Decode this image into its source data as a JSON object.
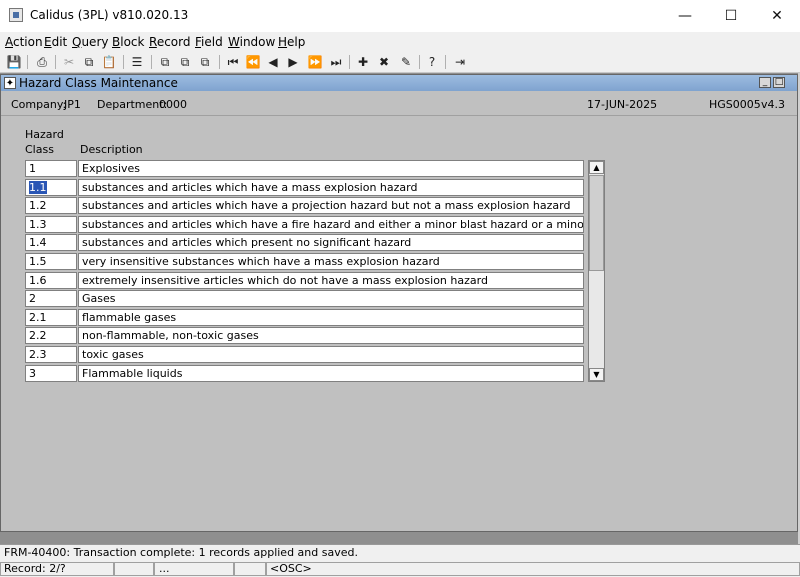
{
  "window": {
    "title": "Calidus (3PL) v810.020.13",
    "minimize": "—",
    "maximize": "☐",
    "close": "✕"
  },
  "menu": [
    {
      "u": "A",
      "rest": "ction"
    },
    {
      "u": "E",
      "rest": "dit"
    },
    {
      "u": "Q",
      "rest": "uery"
    },
    {
      "u": "B",
      "rest": "lock"
    },
    {
      "u": "R",
      "rest": "ecord"
    },
    {
      "u": "F",
      "rest": "ield"
    },
    {
      "u": "W",
      "rest": "indow"
    },
    {
      "u": "H",
      "rest": "elp"
    }
  ],
  "toolbar": {
    "save": "💾",
    "print": "⎙",
    "cut": "✂",
    "copy": "⧉",
    "paste": "📋",
    "list": "☰",
    "t1": "⧉",
    "t2": "⧉",
    "t3": "⧉",
    "first": "⏮",
    "prev_block": "⏪",
    "prev": "◀",
    "next": "▶",
    "next_block": "⏩",
    "last": "⏭",
    "insert": "✚",
    "delete": "✖",
    "clear": "✎",
    "help": "?",
    "exit": "⇥"
  },
  "form": {
    "title": "Hazard Class Maintenance",
    "icon": "✦",
    "min": "_",
    "max": "□",
    "company_label": "Company:",
    "company": "JP1",
    "department_label": "Department:",
    "department": "0000",
    "date": "17-JUN-2025",
    "form_id": "HGS0005",
    "version": "v4.3",
    "col_class_1": "Hazard",
    "col_class_2": "Class",
    "col_desc": "Description",
    "rows": [
      {
        "cls": "1",
        "desc": "Explosives"
      },
      {
        "cls": "1.1",
        "desc": "substances and articles which have a mass explosion hazard"
      },
      {
        "cls": "1.2",
        "desc": "substances and articles which have a projection hazard but not a mass explosion hazard"
      },
      {
        "cls": "1.3",
        "desc": "substances and articles which have a fire hazard and either a minor blast hazard or a minor projection hazard"
      },
      {
        "cls": "1.4",
        "desc": "substances and articles which present no significant hazard"
      },
      {
        "cls": "1.5",
        "desc": "very insensitive substances which have a mass explosion hazard"
      },
      {
        "cls": "1.6",
        "desc": "extremely insensitive articles which do not have a mass explosion hazard"
      },
      {
        "cls": "2",
        "desc": "Gases"
      },
      {
        "cls": "2.1",
        "desc": "flammable gases"
      },
      {
        "cls": "2.2",
        "desc": "non-flammable, non-toxic gases"
      },
      {
        "cls": "2.3",
        "desc": "toxic gases"
      },
      {
        "cls": "3",
        "desc": "Flammable liquids"
      }
    ],
    "selected_row": 1,
    "scroll_up": "▲",
    "scroll_down": "▼"
  },
  "message": "FRM-40400: Transaction complete: 1 records applied and saved.",
  "status": {
    "record": "Record: 2/?",
    "seg3": "...",
    "osc": "<OSC>"
  }
}
